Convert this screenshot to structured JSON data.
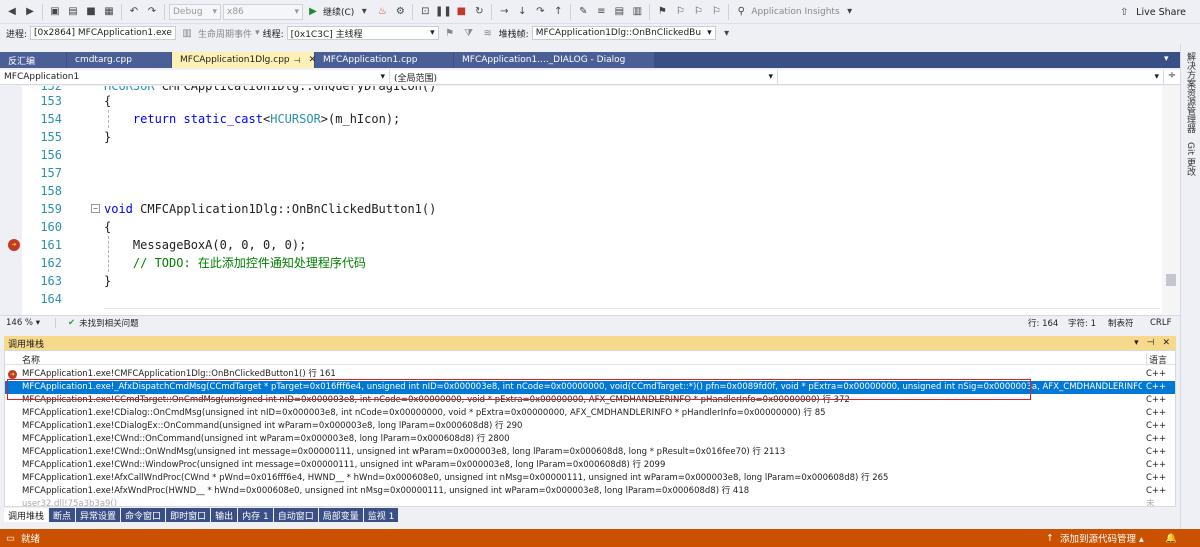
{
  "toolbar1": {
    "config": "Debug",
    "platform": "x86",
    "continue_label": "继续(C)",
    "app_insights": "Application Insights",
    "live_share": "Live Share"
  },
  "toolbar2": {
    "process_label": "进程:",
    "process_value": "[0x2864] MFCApplication1.exe",
    "lifecycle_label": "生命周期事件",
    "thread_label": "线程:",
    "thread_value": "[0x1C3C] 主线程",
    "stackframe_label": "堆栈帧:",
    "stackframe_value": "MFCApplication1Dlg::OnBnClickedBu"
  },
  "tabs": [
    {
      "label": "反汇编",
      "active": false
    },
    {
      "label": "cmdtarg.cpp",
      "active": false
    },
    {
      "label": "MFCApplication1Dlg.cpp",
      "active": true
    },
    {
      "label": "MFCApplication1.cpp",
      "active": false
    },
    {
      "label": "MFCApplication1...._DIALOG - Dialog",
      "active": false
    }
  ],
  "rightbar": {
    "solution_explorer": "解决方案资源管理器",
    "git_changes": "Git 更改"
  },
  "navbar": {
    "project": "MFCApplication1",
    "scope": "(全局范围)"
  },
  "code_lines": [
    {
      "n": "152",
      "text": "HCURSOR CMFCApplication1Dlg::OnQueryDragIcon()"
    },
    {
      "n": "153",
      "text": "{"
    },
    {
      "n": "154",
      "text": "    return static_cast<HCURSOR>(m_hIcon);"
    },
    {
      "n": "155",
      "text": "}"
    },
    {
      "n": "156",
      "text": ""
    },
    {
      "n": "157",
      "text": ""
    },
    {
      "n": "158",
      "text": ""
    },
    {
      "n": "159",
      "text": "void CMFCApplication1Dlg::OnBnClickedButton1()"
    },
    {
      "n": "160",
      "text": "{"
    },
    {
      "n": "161",
      "text": "    MessageBoxA(0, 0, 0, 0);"
    },
    {
      "n": "162",
      "text": "    // TODO: 在此添加控件通知处理程序代码"
    },
    {
      "n": "163",
      "text": "}"
    },
    {
      "n": "164",
      "text": ""
    }
  ],
  "edstatus": {
    "zoom": "146 %",
    "issues": "未找到相关问题",
    "line": "行: 164",
    "col": "字符: 1",
    "tabs": "制表符",
    "eol": "CRLF"
  },
  "callstack": {
    "title": "调用堆栈",
    "col_name": "名称",
    "col_lang": "语言",
    "rows": [
      {
        "name": "MFCApplication1.exe!CMFCApplication1Dlg::OnBnClickedButton1() 行 161",
        "lang": "C++"
      },
      {
        "name": "MFCApplication1.exe!_AfxDispatchCmdMsg(CCmdTarget * pTarget=0x016fff6e4, unsigned int nID=0x000003e8, int nCode=0x00000000, void(CCmdTarget::*)() pfn=0x0089fd0f, void * pExtra=0x00000000, unsigned int nSig=0x0000003a, AFX_CMDHANDLERINFO * pHandlerInfo=0...",
        "lang": "C++"
      },
      {
        "name": "MFCApplication1.exe!CCmdTarget::OnCmdMsg(unsigned int nID=0x000003e8, int nCode=0x00000000, void * pExtra=0x00000000, AFX_CMDHANDLERINFO * pHandlerInfo=0x00000000) 行 372",
        "lang": "C++"
      },
      {
        "name": "MFCApplication1.exe!CDialog::OnCmdMsg(unsigned int nID=0x000003e8, int nCode=0x00000000, void * pExtra=0x00000000, AFX_CMDHANDLERINFO * pHandlerInfo=0x00000000) 行 85",
        "lang": "C++"
      },
      {
        "name": "MFCApplication1.exe!CDialogEx::OnCommand(unsigned int wParam=0x000003e8, long lParam=0x000608d8) 行 290",
        "lang": "C++"
      },
      {
        "name": "MFCApplication1.exe!CWnd::OnCommand(unsigned int wParam=0x000003e8, long lParam=0x000608d8) 行 2800",
        "lang": "C++"
      },
      {
        "name": "MFCApplication1.exe!CWnd::OnWndMsg(unsigned int message=0x00000111, unsigned int wParam=0x000003e8, long lParam=0x000608d8, long * pResult=0x016fee70) 行 2113",
        "lang": "C++"
      },
      {
        "name": "MFCApplication1.exe!CWnd::WindowProc(unsigned int message=0x00000111, unsigned int wParam=0x000003e8, long lParam=0x000608d8) 行 2099",
        "lang": "C++"
      },
      {
        "name": "MFCApplication1.exe!AfxCallWndProc(CWnd * pWnd=0x016fff6e4, HWND__ * hWnd=0x000608e0, unsigned int nMsg=0x00000111, unsigned int wParam=0x000003e8, long lParam=0x000608d8) 行 265",
        "lang": "C++"
      },
      {
        "name": "MFCApplication1.exe!AfxWndProc(HWND__ * hWnd=0x000608e0, unsigned int nMsg=0x00000111, unsigned int wParam=0x000003e8, long lParam=0x000608d8) 行 418",
        "lang": "C++"
      },
      {
        "name": "user32.dll!75a3b3a9()",
        "lang": "未"
      }
    ]
  },
  "bottom_tabs": [
    {
      "label": "调用堆栈",
      "active": true
    },
    {
      "label": "断点",
      "active": false
    },
    {
      "label": "异常设置",
      "active": false
    },
    {
      "label": "命令窗口",
      "active": false
    },
    {
      "label": "即时窗口",
      "active": false
    },
    {
      "label": "输出",
      "active": false
    },
    {
      "label": "内存 1",
      "active": false
    },
    {
      "label": "自动窗口",
      "active": false
    },
    {
      "label": "局部变量",
      "active": false
    },
    {
      "label": "监视 1",
      "active": false
    }
  ],
  "statusbar": {
    "ready": "就绪",
    "source_control": "添加到源代码管理"
  },
  "colors": {
    "statusbar": "#ca5100",
    "tab_active": "#fdf0b4",
    "selection": "#0078d7",
    "keyword": "#0000ff"
  }
}
